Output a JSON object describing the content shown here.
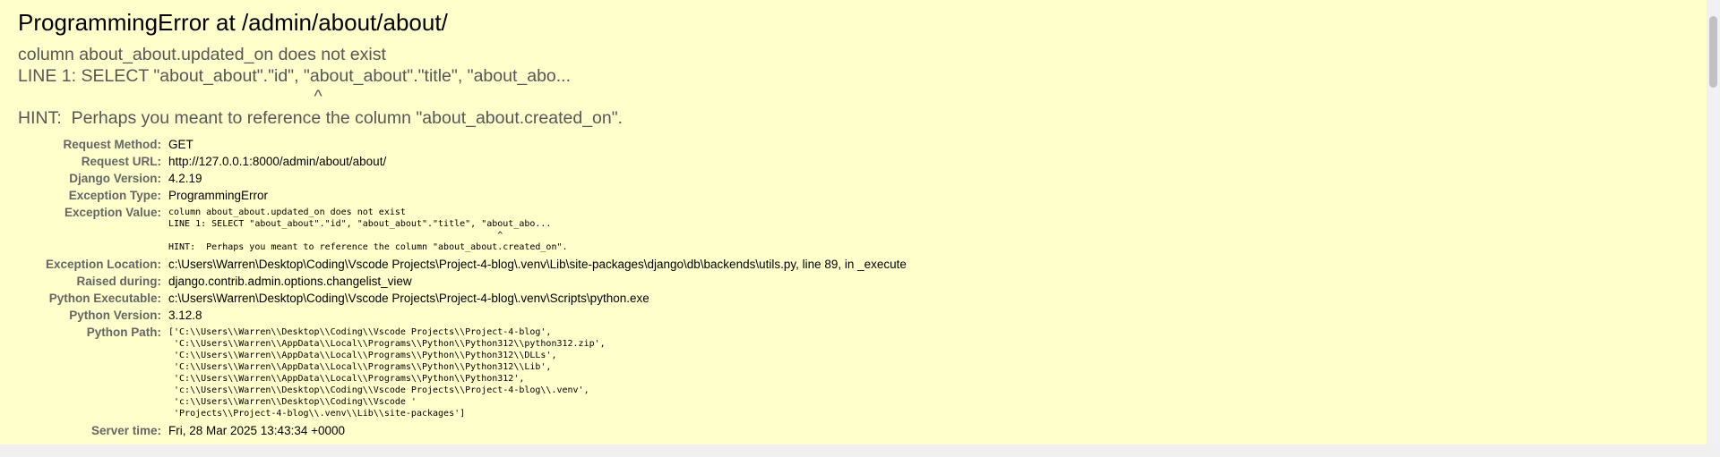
{
  "title": "ProgrammingError at /admin/about/about/",
  "exception_summary": "column about_about.updated_on does not exist\nLINE 1: SELECT \"about_about\".\"id\", \"about_about\".\"title\", \"about_abo...\n                                                             ^\nHINT:  Perhaps you meant to reference the column \"about_about.created_on\".",
  "meta": {
    "request_method": {
      "label": "Request Method:",
      "value": "GET"
    },
    "request_url": {
      "label": "Request URL:",
      "value": "http://127.0.0.1:8000/admin/about/about/"
    },
    "django_version": {
      "label": "Django Version:",
      "value": "4.2.19"
    },
    "exception_type": {
      "label": "Exception Type:",
      "value": "ProgrammingError"
    },
    "exception_value": {
      "label": "Exception Value:",
      "value": "column about_about.updated_on does not exist\nLINE 1: SELECT \"about_about\".\"id\", \"about_about\".\"title\", \"about_abo...\n                                                             ^\nHINT:  Perhaps you meant to reference the column \"about_about.created_on\"."
    },
    "exception_location": {
      "label": "Exception Location:",
      "value": "c:\\Users\\Warren\\Desktop\\Coding\\Vscode Projects\\Project-4-blog\\.venv\\Lib\\site-packages\\django\\db\\backends\\utils.py, line 89, in _execute"
    },
    "raised_during": {
      "label": "Raised during:",
      "value": "django.contrib.admin.options.changelist_view"
    },
    "python_executable": {
      "label": "Python Executable:",
      "value": "c:\\Users\\Warren\\Desktop\\Coding\\Vscode Projects\\Project-4-blog\\.venv\\Scripts\\python.exe"
    },
    "python_version": {
      "label": "Python Version:",
      "value": "3.12.8"
    },
    "python_path": {
      "label": "Python Path:",
      "value": "['C:\\\\Users\\\\Warren\\\\Desktop\\\\Coding\\\\Vscode Projects\\\\Project-4-blog',\n 'C:\\\\Users\\\\Warren\\\\AppData\\\\Local\\\\Programs\\\\Python\\\\Python312\\\\python312.zip',\n 'C:\\\\Users\\\\Warren\\\\AppData\\\\Local\\\\Programs\\\\Python\\\\Python312\\\\DLLs',\n 'C:\\\\Users\\\\Warren\\\\AppData\\\\Local\\\\Programs\\\\Python\\\\Python312\\\\Lib',\n 'C:\\\\Users\\\\Warren\\\\AppData\\\\Local\\\\Programs\\\\Python\\\\Python312',\n 'c:\\\\Users\\\\Warren\\\\Desktop\\\\Coding\\\\Vscode Projects\\\\Project-4-blog\\\\.venv',\n 'c:\\\\Users\\\\Warren\\\\Desktop\\\\Coding\\\\Vscode '\n 'Projects\\\\Project-4-blog\\\\.venv\\\\Lib\\\\site-packages']"
    },
    "server_time": {
      "label": "Server time:",
      "value": "Fri, 28 Mar 2025 13:43:34 +0000"
    }
  }
}
